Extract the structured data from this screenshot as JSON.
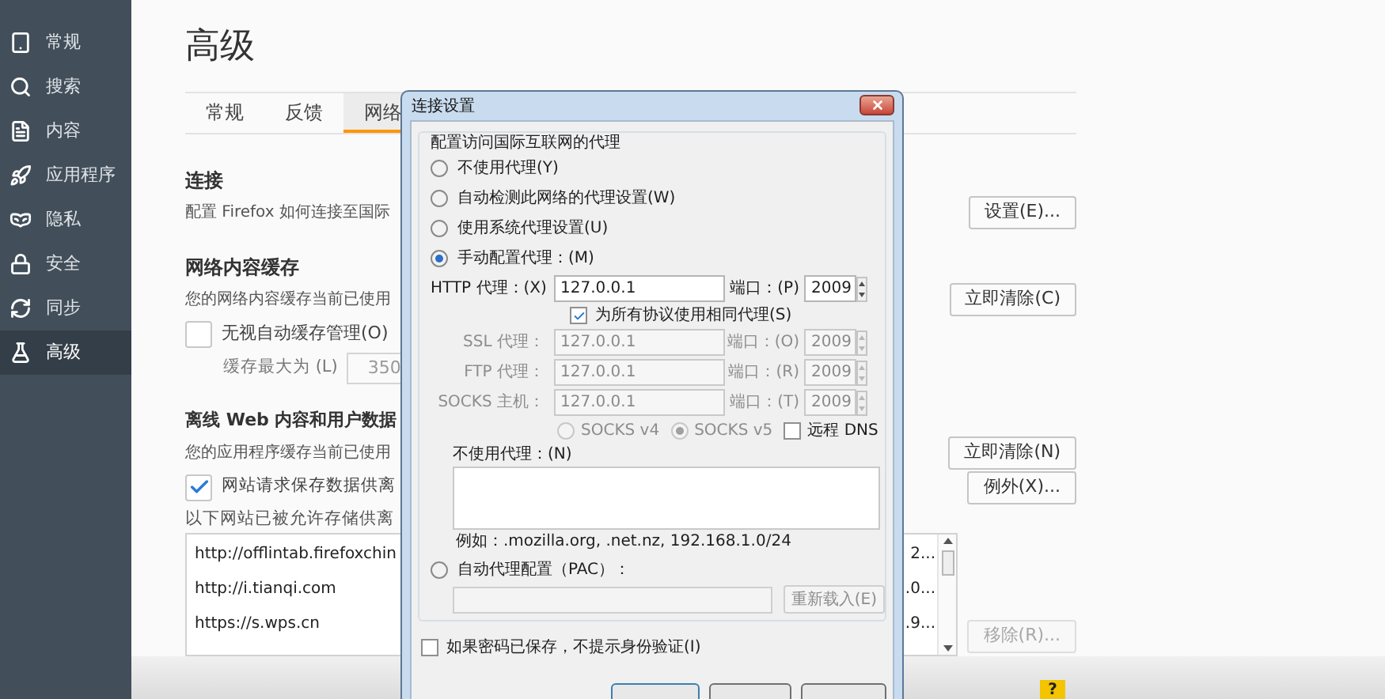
{
  "sidebar": {
    "items": [
      {
        "label": "常规",
        "selected": false
      },
      {
        "label": "搜索",
        "selected": false
      },
      {
        "label": "内容",
        "selected": false
      },
      {
        "label": "应用程序",
        "selected": false
      },
      {
        "label": "隐私",
        "selected": false
      },
      {
        "label": "安全",
        "selected": false
      },
      {
        "label": "同步",
        "selected": false
      },
      {
        "label": "高级",
        "selected": true
      }
    ]
  },
  "page": {
    "title": "高级",
    "tabs": [
      {
        "label": "常规",
        "selected": false
      },
      {
        "label": "反馈",
        "selected": false
      },
      {
        "label": "网络",
        "selected": true
      }
    ]
  },
  "connection": {
    "heading": "连接",
    "description": "配置 Firefox 如何连接至国际",
    "button": "设置(E)..."
  },
  "cache": {
    "heading": "网络内容缓存",
    "description": "您的网络内容缓存当前已使用",
    "button": "立即清除(C)",
    "override": {
      "label": "无视自动缓存管理(O)",
      "checked": false
    },
    "limit_label": "缓存最大为 (L)",
    "limit_value": "350"
  },
  "offline": {
    "heading": "离线 Web 内容和用户数据",
    "description": "您的应用程序缓存当前已使用",
    "clear_button": "立即清除(N)",
    "notify": {
      "label": "网站请求保存数据供离",
      "checked": true
    },
    "exceptions_button": "例外(X)...",
    "list_label": "以下网站已被允许存储供离",
    "sites": [
      {
        "site": "http://offlintab.firefoxchin",
        "column_2": "2..."
      },
      {
        "site": "http://i.tianqi.com",
        "column_2": ".0..."
      },
      {
        "site": "https://s.wps.cn",
        "column_2": ".9..."
      }
    ],
    "remove_button": {
      "label": "移除(R)...",
      "disabled": true
    }
  },
  "help_badge": "?",
  "dialog": {
    "title": "连接设置",
    "group_label": "配置访问国际互联网的代理",
    "modes": [
      {
        "label": "不使用代理(Y)",
        "selected": false
      },
      {
        "label": "自动检测此网络的代理设置(W)",
        "selected": false
      },
      {
        "label": "使用系统代理设置(U)",
        "selected": false
      },
      {
        "label": "手动配置代理：(M)",
        "selected": true
      }
    ],
    "http_proxy": {
      "label": "HTTP 代理：(X)",
      "value": "127.0.0.1",
      "port_label": "端口：(P)",
      "port": "2009",
      "disabled": false
    },
    "same_proxy": {
      "label": "为所有协议使用相同代理(S)",
      "checked": true
    },
    "other_proxies": [
      {
        "label": "SSL 代理：",
        "value": "127.0.0.1",
        "port_label": "端口：(O)",
        "port": "2009",
        "disabled": true
      },
      {
        "label": "FTP 代理：",
        "value": "127.0.0.1",
        "port_label": "端口：(R)",
        "port": "2009",
        "disabled": true
      },
      {
        "label": "SOCKS 主机：",
        "value": "127.0.0.1",
        "port_label": "端口：(T)",
        "port": "2009",
        "disabled": true
      }
    ],
    "socks_versions": [
      {
        "label": "SOCKS v4",
        "selected": false,
        "disabled": true
      },
      {
        "label": "SOCKS v5",
        "selected": true,
        "disabled": true
      }
    ],
    "remote_dns": {
      "label": "远程 DNS",
      "checked": false
    },
    "no_proxy_label": "不使用代理：(N)",
    "no_proxy_example": "例如：.mozilla.org, .net.nz, 192.168.1.0/24",
    "pac": {
      "label": "自动代理配置（PAC）：",
      "selected": false,
      "disabled": true,
      "reload_button": "重新载入(E)"
    },
    "auth": {
      "label": "如果密码已保存，不提示身份验证(I)",
      "checked": false
    }
  }
}
